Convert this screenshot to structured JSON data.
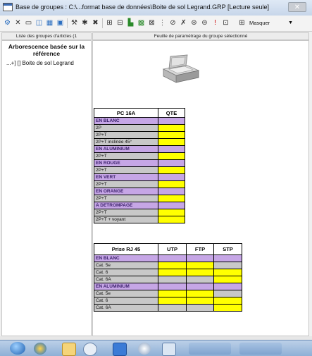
{
  "window": {
    "title": "Base de groupes : C:\\...format base de données\\Boite de sol Legrand.GRP [Lecture seule]",
    "close_label": "✕"
  },
  "toolbar": {
    "icons": [
      "gear-icon",
      "close-small-icon",
      "minus-icon",
      "panel-icon",
      "grid-icon",
      "image-icon",
      "tools-icon",
      "star-icon",
      "cross-icon",
      "link-icon",
      "split-icon",
      "chart-icon",
      "grid2-icon",
      "sort-icon",
      "filter-icon",
      "delete-icon",
      "copy-icon",
      "lock-icon",
      "info-icon",
      "columns-icon"
    ],
    "masquer_label": "Masquer"
  },
  "left": {
    "header": "Liste des groupes d'articles (1",
    "tree_title": "Arborescence basée sur la référence",
    "tree_item": "...+] [] Boite de sol Legrand"
  },
  "right": {
    "header": "Feuille de paramétrage du groupe sélectionné"
  },
  "table1": {
    "col1": "PC 16A",
    "col2": "QTE",
    "rows": [
      {
        "type": "section",
        "label": "EN BLANC"
      },
      {
        "type": "item",
        "label": "2P",
        "fill": "yellow"
      },
      {
        "type": "item",
        "label": "2P+T",
        "fill": "yellow"
      },
      {
        "type": "item",
        "label": "2P+T inclinée 45°",
        "fill": "yellow"
      },
      {
        "type": "section",
        "label": "EN ALUMINIUM"
      },
      {
        "type": "item",
        "label": "2P+T",
        "fill": "yellow"
      },
      {
        "type": "section",
        "label": "EN ROUGE"
      },
      {
        "type": "item",
        "label": "2P+T",
        "fill": "yellow"
      },
      {
        "type": "section",
        "label": "EN VERT"
      },
      {
        "type": "item",
        "label": "2P+T",
        "fill": "yellow"
      },
      {
        "type": "section",
        "label": "EN ORANGE"
      },
      {
        "type": "item",
        "label": "2P+T",
        "fill": "yellow"
      },
      {
        "type": "section",
        "label": "A DETROMPAGE"
      },
      {
        "type": "item",
        "label": "2P+T",
        "fill": "yellow"
      },
      {
        "type": "item",
        "label": "2P+T + voyant",
        "fill": "yellow"
      }
    ]
  },
  "table2": {
    "col1": "Prise RJ 45",
    "col2": "UTP",
    "col3": "FTP",
    "col4": "STP",
    "rows": [
      {
        "type": "section",
        "label": "EN BLANC"
      },
      {
        "type": "item",
        "label": "Cat. 5e",
        "fills": [
          "yellow",
          "yellow",
          "grey"
        ]
      },
      {
        "type": "item",
        "label": "Cat. 6",
        "fills": [
          "yellow",
          "yellow",
          "yellow"
        ]
      },
      {
        "type": "item",
        "label": "Cat. 6A",
        "fills": [
          "grey",
          "grey",
          "yellow"
        ]
      },
      {
        "type": "section",
        "label": "EN ALUMINIUM"
      },
      {
        "type": "item",
        "label": "Cat. 5e",
        "fills": [
          "yellow",
          "yellow",
          "grey"
        ]
      },
      {
        "type": "item",
        "label": "Cat. 6",
        "fills": [
          "yellow",
          "yellow",
          "yellow"
        ]
      },
      {
        "type": "item",
        "label": "Cat. 6A",
        "fills": [
          "grey",
          "grey",
          "yellow"
        ]
      }
    ]
  },
  "colors": {
    "section": "#c6a6e6",
    "label_bg": "#c8c8c8",
    "yellow": "#ffff00"
  },
  "taskbar": {
    "icons": [
      "start-orb-icon",
      "ie-icon",
      "folder-icon",
      "media-icon",
      "app-icon",
      "disk-icon",
      "window-icon"
    ]
  }
}
